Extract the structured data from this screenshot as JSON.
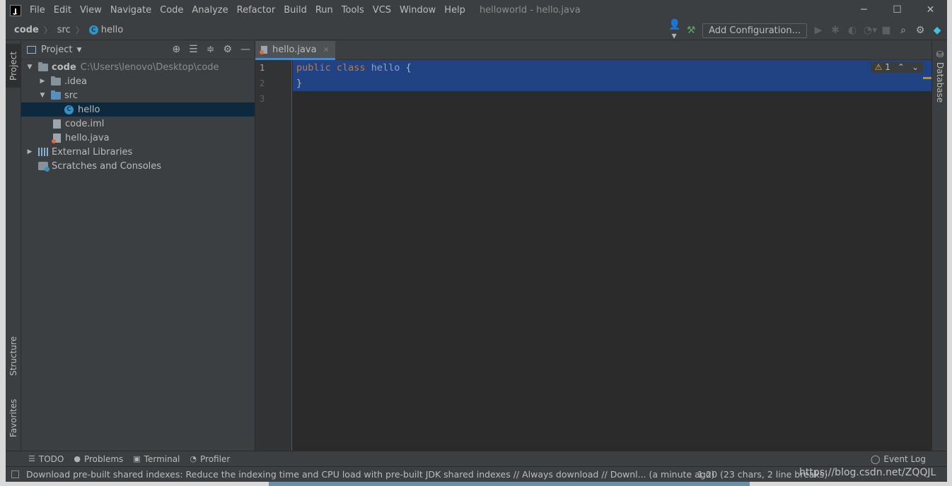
{
  "titlebar": {
    "menu": [
      "File",
      "Edit",
      "View",
      "Navigate",
      "Code",
      "Analyze",
      "Refactor",
      "Build",
      "Run",
      "Tools",
      "VCS",
      "Window",
      "Help"
    ],
    "title": "helloworld - hello.java",
    "minimize": "─",
    "maximize": "☐",
    "close": "✕"
  },
  "navbar": {
    "crumbs": [
      "code",
      "src",
      "hello"
    ],
    "add_configuration": "Add Configuration..."
  },
  "left_strip": {
    "project": "Project",
    "structure": "Structure",
    "favorites": "Favorites"
  },
  "right_strip": {
    "database": "Database"
  },
  "project": {
    "header": "Project",
    "tree": [
      {
        "label": "code",
        "path": "C:\\Users\\lenovo\\Desktop\\code"
      },
      {
        "label": ".idea"
      },
      {
        "label": "src"
      },
      {
        "label": "hello"
      },
      {
        "label": "code.iml"
      },
      {
        "label": "hello.java"
      },
      {
        "label": "External Libraries"
      },
      {
        "label": "Scratches and Consoles"
      }
    ]
  },
  "editor": {
    "tab": "hello.java",
    "line_numbers": [
      "1",
      "2",
      "3"
    ],
    "code": {
      "kw1": "public",
      "kw2": "class",
      "classname": "hello",
      "brace_open": "{",
      "brace_close": "}"
    },
    "warnings": "1"
  },
  "toolwindows": {
    "todo": "TODO",
    "problems": "Problems",
    "terminal": "Terminal",
    "profiler": "Profiler",
    "event_log": "Event Log"
  },
  "status": {
    "message": "Download pre-built shared indexes: Reduce the indexing time and CPU load with pre-built JDK shared indexes // Always download // Downl... (a minute ago)",
    "position": "1:20 (23 chars, 2 line breaks)",
    "watermark": "https://blog.csdn.net/ZQQJL"
  }
}
